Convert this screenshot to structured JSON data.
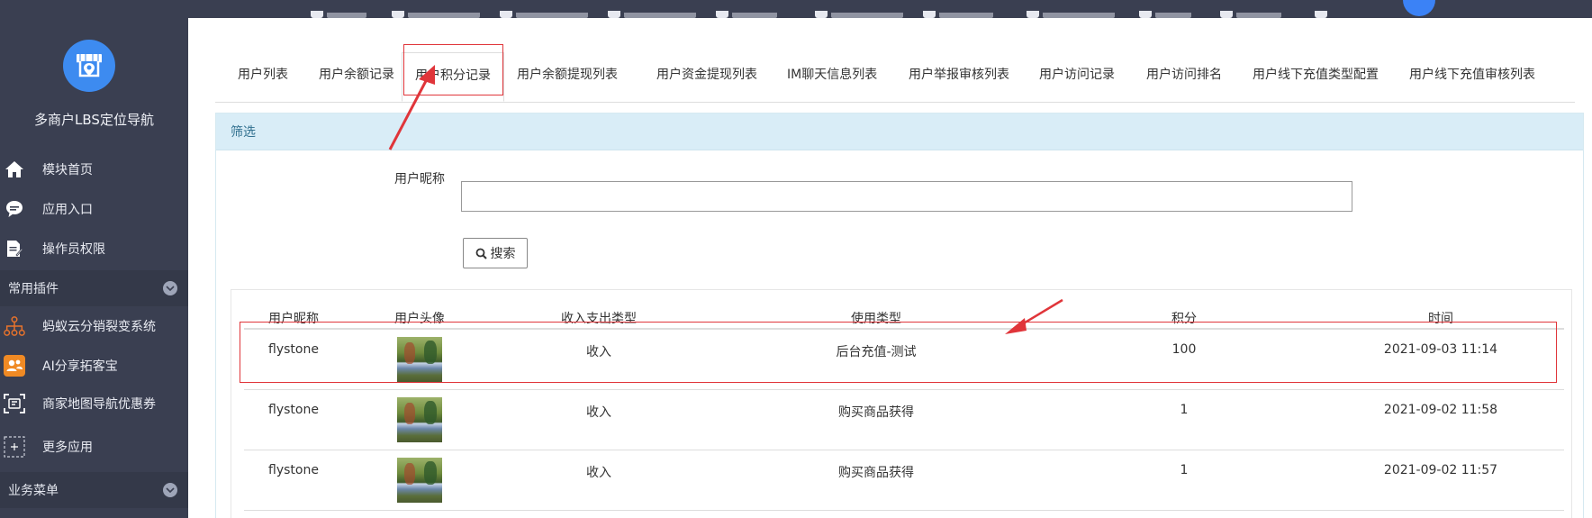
{
  "app": {
    "title": "多商户LBS定位导航"
  },
  "sidebar": {
    "items": [
      {
        "label": "模块首页",
        "icon": "home-icon"
      },
      {
        "label": "应用入口",
        "icon": "chat-icon"
      },
      {
        "label": "操作员权限",
        "icon": "document-edit-icon"
      }
    ],
    "section_plugins": {
      "label": "常用插件"
    },
    "plugins": [
      {
        "label": "蚂蚁云分销裂变系统",
        "icon": "network-icon"
      },
      {
        "label": "AI分享拓客宝",
        "icon": "share-users-icon"
      },
      {
        "label": "商家地图导航优惠券",
        "icon": "scan-icon"
      },
      {
        "label": "更多应用",
        "icon": "plus-icon"
      }
    ],
    "section_business": {
      "label": "业务菜单"
    }
  },
  "tabs": [
    {
      "label": "用户列表"
    },
    {
      "label": "用户余额记录"
    },
    {
      "label": "用户积分记录",
      "active": true
    },
    {
      "label": "用户余额提现列表"
    },
    {
      "label": "用户资金提现列表"
    },
    {
      "label": "IM聊天信息列表"
    },
    {
      "label": "用户举报审核列表"
    },
    {
      "label": "用户访问记录"
    },
    {
      "label": "用户访问排名"
    },
    {
      "label": "用户线下充值类型配置"
    },
    {
      "label": "用户线下充值审核列表"
    }
  ],
  "filter": {
    "panel_title": "筛选",
    "nickname_label": "用户昵称",
    "nickname_value": "",
    "search_label": "搜索"
  },
  "table": {
    "headers": [
      "用户昵称",
      "用户头像",
      "收入支出类型",
      "使用类型",
      "积分",
      "时间"
    ],
    "rows": [
      {
        "nickname": "flystone",
        "type": "收入",
        "usage": "后台充值-测试",
        "points": "100",
        "time": "2021-09-03 11:14"
      },
      {
        "nickname": "flystone",
        "type": "收入",
        "usage": "购买商品获得",
        "points": "1",
        "time": "2021-09-02 11:58"
      },
      {
        "nickname": "flystone",
        "type": "收入",
        "usage": "购买商品获得",
        "points": "1",
        "time": "2021-09-02 11:57"
      }
    ]
  },
  "colors": {
    "sidebar": "#3a3f51",
    "accent": "#3d8bf0",
    "annotation": "#e0353a",
    "panel_head": "#d9edf7"
  }
}
